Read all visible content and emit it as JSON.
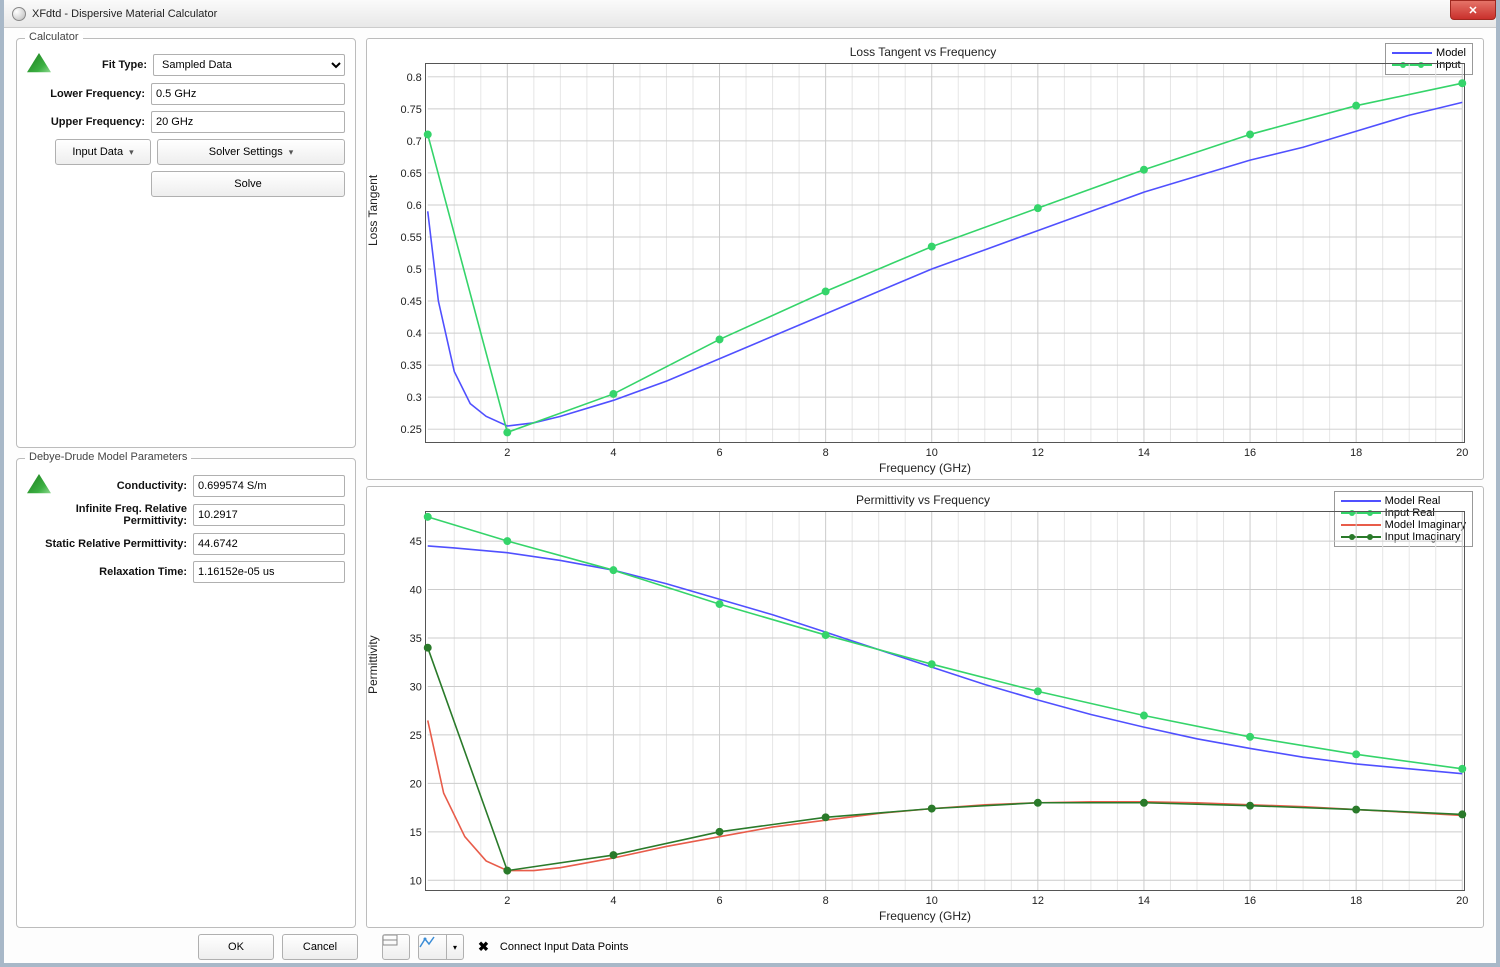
{
  "window": {
    "title": "XFdtd - Dispersive Material Calculator"
  },
  "calculator": {
    "legend": "Calculator",
    "fit_type_label": "Fit Type:",
    "fit_type_value": "Sampled Data",
    "lower_freq_label": "Lower Frequency:",
    "lower_freq_value": "0.5 GHz",
    "upper_freq_label": "Upper Frequency:",
    "upper_freq_value": "20 GHz",
    "input_data_btn": "Input Data",
    "solver_settings_btn": "Solver Settings",
    "solve_btn": "Solve"
  },
  "debye": {
    "legend": "Debye-Drude Model Parameters",
    "conductivity_label": "Conductivity:",
    "conductivity_value": "0.699574 S/m",
    "inf_perm_label": "Infinite Freq. Relative Permittivity:",
    "inf_perm_value": "10.2917",
    "static_perm_label": "Static Relative Permittivity:",
    "static_perm_value": "44.6742",
    "relax_time_label": "Relaxation Time:",
    "relax_time_value": "1.16152e-05 us"
  },
  "chart_data": [
    {
      "id": "loss_tangent",
      "type": "line",
      "title": "Loss Tangent vs Frequency",
      "xlabel": "Frequency (GHz)",
      "ylabel": "Loss Tangent",
      "xlim": [
        0.5,
        20
      ],
      "ylim": [
        0.23,
        0.82
      ],
      "yticks": [
        0.25,
        0.3,
        0.35,
        0.4,
        0.45,
        0.5,
        0.55,
        0.6,
        0.65,
        0.7,
        0.75,
        0.8
      ],
      "xticks": [
        2,
        4,
        6,
        8,
        10,
        12,
        14,
        16,
        18,
        20
      ],
      "legend": [
        "Model",
        "Input"
      ],
      "series": [
        {
          "name": "Model",
          "color": "#5050ff",
          "marker": false,
          "x": [
            0.5,
            0.7,
            1,
            1.3,
            1.6,
            2,
            2.5,
            3,
            4,
            5,
            6,
            7,
            8,
            9,
            10,
            11,
            12,
            13,
            14,
            15,
            16,
            17,
            18,
            19,
            20
          ],
          "y": [
            0.59,
            0.45,
            0.34,
            0.29,
            0.27,
            0.255,
            0.26,
            0.27,
            0.295,
            0.325,
            0.36,
            0.395,
            0.43,
            0.465,
            0.5,
            0.53,
            0.56,
            0.59,
            0.62,
            0.645,
            0.67,
            0.69,
            0.715,
            0.74,
            0.76
          ]
        },
        {
          "name": "Input",
          "color": "#35d46a",
          "marker": true,
          "x": [
            0.5,
            2,
            4,
            6,
            8,
            10,
            12,
            14,
            16,
            18,
            20
          ],
          "y": [
            0.71,
            0.245,
            0.305,
            0.39,
            0.465,
            0.535,
            0.595,
            0.655,
            0.71,
            0.755,
            0.79
          ]
        }
      ]
    },
    {
      "id": "permittivity",
      "type": "line",
      "title": "Permittivity vs Frequency",
      "xlabel": "Frequency (GHz)",
      "ylabel": "Permittivity",
      "xlim": [
        0.5,
        20
      ],
      "ylim": [
        9,
        48
      ],
      "yticks": [
        10,
        15,
        20,
        25,
        30,
        35,
        40,
        45
      ],
      "xticks": [
        2,
        4,
        6,
        8,
        10,
        12,
        14,
        16,
        18,
        20
      ],
      "legend": [
        "Model Real",
        "Input Real",
        "Model Imaginary",
        "Input Imaginary"
      ],
      "series": [
        {
          "name": "Model Real",
          "color": "#5050ff",
          "marker": false,
          "x": [
            0.5,
            1,
            2,
            3,
            4,
            5,
            6,
            7,
            8,
            9,
            10,
            11,
            12,
            13,
            14,
            15,
            16,
            17,
            18,
            19,
            20
          ],
          "y": [
            44.5,
            44.3,
            43.8,
            43,
            42,
            40.6,
            39,
            37.4,
            35.6,
            33.8,
            32,
            30.2,
            28.6,
            27.1,
            25.8,
            24.6,
            23.6,
            22.7,
            22,
            21.5,
            21
          ]
        },
        {
          "name": "Input Real",
          "color": "#35d46a",
          "marker": true,
          "x": [
            0.5,
            2,
            4,
            6,
            8,
            10,
            12,
            14,
            16,
            18,
            20
          ],
          "y": [
            47.5,
            45,
            42,
            38.5,
            35.3,
            32.3,
            29.5,
            27,
            24.8,
            23,
            21.5
          ]
        },
        {
          "name": "Model Imaginary",
          "color": "#e85c4a",
          "marker": false,
          "x": [
            0.5,
            0.8,
            1.2,
            1.6,
            2,
            2.5,
            3,
            4,
            5,
            6,
            7,
            8,
            9,
            10,
            11,
            12,
            13,
            14,
            15,
            16,
            17,
            18,
            19,
            20
          ],
          "y": [
            26.5,
            19,
            14.5,
            12,
            11,
            11,
            11.3,
            12.3,
            13.5,
            14.5,
            15.5,
            16.2,
            16.9,
            17.4,
            17.8,
            18,
            18.1,
            18.1,
            18,
            17.8,
            17.6,
            17.3,
            17,
            16.7
          ]
        },
        {
          "name": "Input Imaginary",
          "color": "#2a7a2a",
          "marker": true,
          "x": [
            0.5,
            2,
            4,
            6,
            8,
            10,
            12,
            14,
            16,
            18,
            20
          ],
          "y": [
            34,
            11,
            12.6,
            15,
            16.5,
            17.4,
            18,
            18,
            17.7,
            17.3,
            16.8
          ]
        }
      ]
    }
  ],
  "footer": {
    "ok": "OK",
    "cancel": "Cancel",
    "connect_label": "Connect Input Data Points"
  }
}
